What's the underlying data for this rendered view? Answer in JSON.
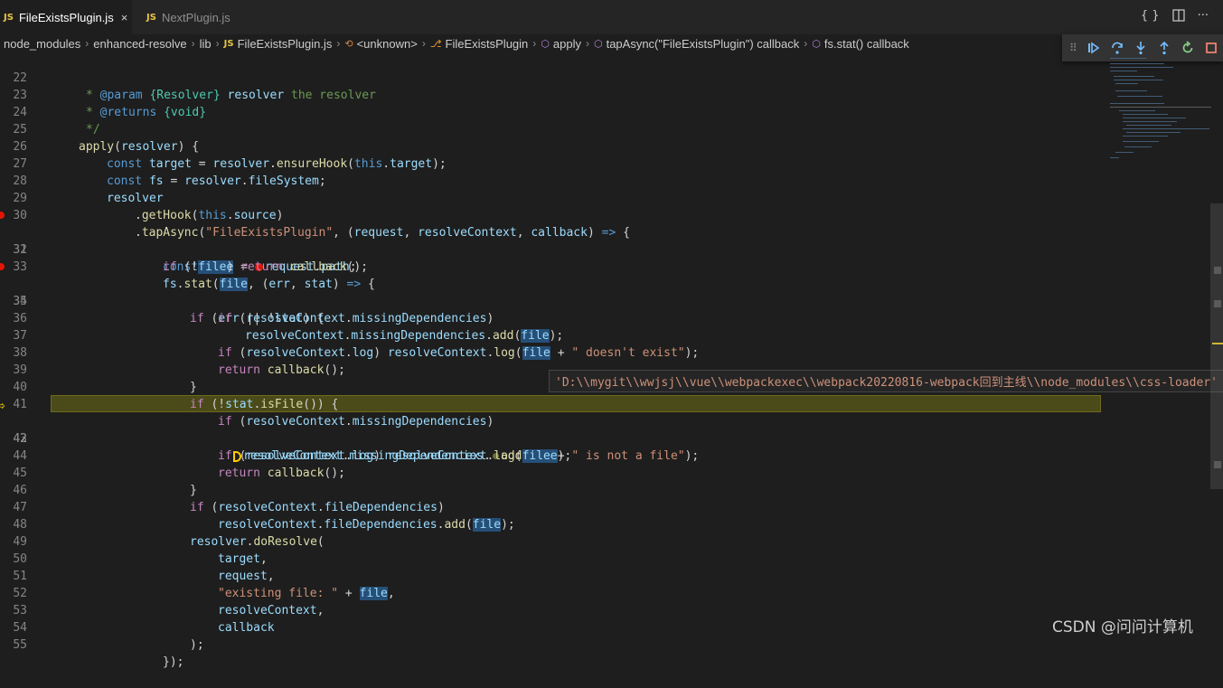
{
  "tabs": [
    {
      "label": "FileExistsPlugin.js",
      "badge": "JS",
      "close": "×",
      "active": true
    },
    {
      "label": "NextPlugin.js",
      "badge": "JS",
      "active": false
    }
  ],
  "tab_actions": {
    "braces": "{ }",
    "split": "split-editor-icon",
    "more": "···"
  },
  "breadcrumb": [
    {
      "label": "node_modules"
    },
    {
      "label": "enhanced-resolve"
    },
    {
      "label": "lib"
    },
    {
      "label": "FileExistsPlugin.js",
      "icon": "JS"
    },
    {
      "label": "<unknown>",
      "icon": "unknown-symbol-icon"
    },
    {
      "label": "FileExistsPlugin",
      "icon": "class-icon"
    },
    {
      "label": "apply",
      "icon": "method-icon"
    },
    {
      "label": "tapAsync(\"FileExistsPlugin\") callback",
      "icon": "method-icon"
    },
    {
      "label": "fs.stat() callback",
      "icon": "method-icon"
    }
  ],
  "debug_toolbar": [
    "continue",
    "step-over",
    "step-into",
    "step-out",
    "restart",
    "stop"
  ],
  "line_numbers": [
    "22",
    "23",
    "24",
    "25",
    "26",
    "27",
    "28",
    "29",
    "30",
    "31",
    "32",
    "33",
    "34",
    "35",
    "36",
    "37",
    "38",
    "39",
    "40",
    "41",
    "42",
    "43",
    "44",
    "45",
    "46",
    "47",
    "48",
    "49",
    "50",
    "51",
    "52",
    "53",
    "54",
    "55"
  ],
  "current_line": "42",
  "breakpoint_lines": [
    "31",
    "34"
  ],
  "hover_value": "'D:\\\\mygit\\\\wwjsj\\\\vue\\\\webpackexec\\\\webpack20220816-webpack回到主线\\\\node_modules\\\\css-loader'",
  "watermark": "CSDN @问问计算机",
  "code": {
    "l22_a": "* ",
    "l22_tag": "@param",
    "l22_type": " {Resolver}",
    "l22_var": " resolver",
    "l22_b": " the resolver",
    "l23_a": "* ",
    "l23_tag": "@returns",
    "l23_type": " {void}",
    "l24": "*/",
    "l25_fn": "apply",
    "l25_a": "(",
    "l25_var": "resolver",
    "l25_b": ") {",
    "l26_kw": "const",
    "l26_var": " target",
    "l26_a": " = ",
    "l26_obj": "resolver",
    "l26_b": ".",
    "l26_fn": "ensureHook",
    "l26_c": "(",
    "l26_this": "this",
    "l26_d": ".",
    "l26_prop": "target",
    "l26_e": ");",
    "l27_kw": "const",
    "l27_var": " fs",
    "l27_a": " = ",
    "l27_obj": "resolver",
    "l27_b": ".",
    "l27_prop": "fileSystem",
    "l27_c": ";",
    "l28_var": "resolver",
    "l29_a": ".",
    "l29_fn": "getHook",
    "l29_b": "(",
    "l29_this": "this",
    "l29_c": ".",
    "l29_prop": "source",
    "l29_d": ")",
    "l30_a": ".",
    "l30_fn": "tapAsync",
    "l30_b": "(",
    "l30_str": "\"FileExistsPlugin\"",
    "l30_c": ", (",
    "l30_p1": "request",
    "l30_d": ", ",
    "l30_p2": "resolveContext",
    "l30_e": ", ",
    "l30_p3": "callback",
    "l30_f": ") ",
    "l30_arrow": "=>",
    "l30_g": " {",
    "l31_kw": "const",
    "l31_sp": " ",
    "l31_var": "file",
    "l31_a": " = ",
    "l31_obj": "request",
    "l31_b": ".",
    "l31_prop": "path",
    "l31_c": ";",
    "l32_ctl": "if",
    "l32_a": " (!",
    "l32_var": "file",
    "l32_b": ") ",
    "l32_ret": "return",
    "l32_sp": " ",
    "l32_fn": "callback",
    "l32_c": "();",
    "l33_obj": "fs",
    "l33_a": ".",
    "l33_fn": "stat",
    "l33_b": "(",
    "l33_var": "file",
    "l33_c": ", (",
    "l33_p1": "err",
    "l33_d": ", ",
    "l33_p2": "stat",
    "l33_e": ") ",
    "l33_arrow": "=>",
    "l33_f": " {",
    "l34_ctl": "if",
    "l34_a": " (",
    "l34_v1": "err",
    "l34_b": " || !",
    "l34_v2": "stat",
    "l34_c": ") {",
    "l35_ctl": "if",
    "l35_a": " (",
    "l35_obj": "resolveContext",
    "l35_b": ".",
    "l35_prop": "missingDependencies",
    "l35_c": ")",
    "l36_obj": "resolveContext",
    "l36_a": ".",
    "l36_prop": "missingDependencies",
    "l36_b": ".",
    "l36_fn": "add",
    "l36_c": "(",
    "l36_var": "file",
    "l36_d": ");",
    "l37_ctl": "if",
    "l37_a": " (",
    "l37_obj": "resolveContext",
    "l37_b": ".",
    "l37_prop": "log",
    "l37_c": ") ",
    "l37_obj2": "resolveContext",
    "l37_d": ".",
    "l37_fn": "log",
    "l37_e": "(",
    "l37_var": "file",
    "l37_f": " + ",
    "l37_str": "\" doesn't exist\"",
    "l37_g": ");",
    "l38_ret": "return",
    "l38_sp": " ",
    "l38_fn": "callback",
    "l38_a": "();",
    "l39": "}",
    "l40_ctl": "if",
    "l40_a": " (!",
    "l40_obj": "stat",
    "l40_b": ".",
    "l40_fn": "isFile",
    "l40_c": "()) {",
    "l41_ctl": "if",
    "l41_a": " (",
    "l41_obj": "resolveContext",
    "l41_b": ".",
    "l41_prop": "missingDependencies",
    "l41_c": ")",
    "l42_obj": "resolveContext",
    "l42_a": ".",
    "l42_prop": "missingDependencies",
    "l42_b": ".",
    "l42_fn": "add",
    "l42_c": "(",
    "l42_var": "file",
    "l42_d": ");",
    "l43_ctl": "if",
    "l43_a": " (",
    "l43_obj": "resolveContext",
    "l43_b": ".",
    "l43_prop": "log",
    "l43_c": ") ",
    "l43_obj2": "resolveContext",
    "l43_d": ".",
    "l43_fn": "log",
    "l43_e": "(",
    "l43_var": "file",
    "l43_f": " + ",
    "l43_str": "\" is not a file\"",
    "l43_g": ");",
    "l44_ret": "return",
    "l44_sp": " ",
    "l44_fn": "callback",
    "l44_a": "();",
    "l45": "}",
    "l46_ctl": "if",
    "l46_a": " (",
    "l46_obj": "resolveContext",
    "l46_b": ".",
    "l46_prop": "fileDependencies",
    "l46_c": ")",
    "l47_obj": "resolveContext",
    "l47_a": ".",
    "l47_prop": "fileDependencies",
    "l47_b": ".",
    "l47_fn": "add",
    "l47_c": "(",
    "l47_var": "file",
    "l47_d": ");",
    "l48_obj": "resolver",
    "l48_a": ".",
    "l48_fn": "doResolve",
    "l48_b": "(",
    "l49_var": "target",
    "l49_a": ",",
    "l50_var": "request",
    "l50_a": ",",
    "l51_str": "\"existing file: \"",
    "l51_a": " + ",
    "l51_var": "file",
    "l51_b": ",",
    "l52_var": "resolveContext",
    "l52_a": ",",
    "l53_var": "callback",
    "l54": ");",
    "l55": "});"
  }
}
